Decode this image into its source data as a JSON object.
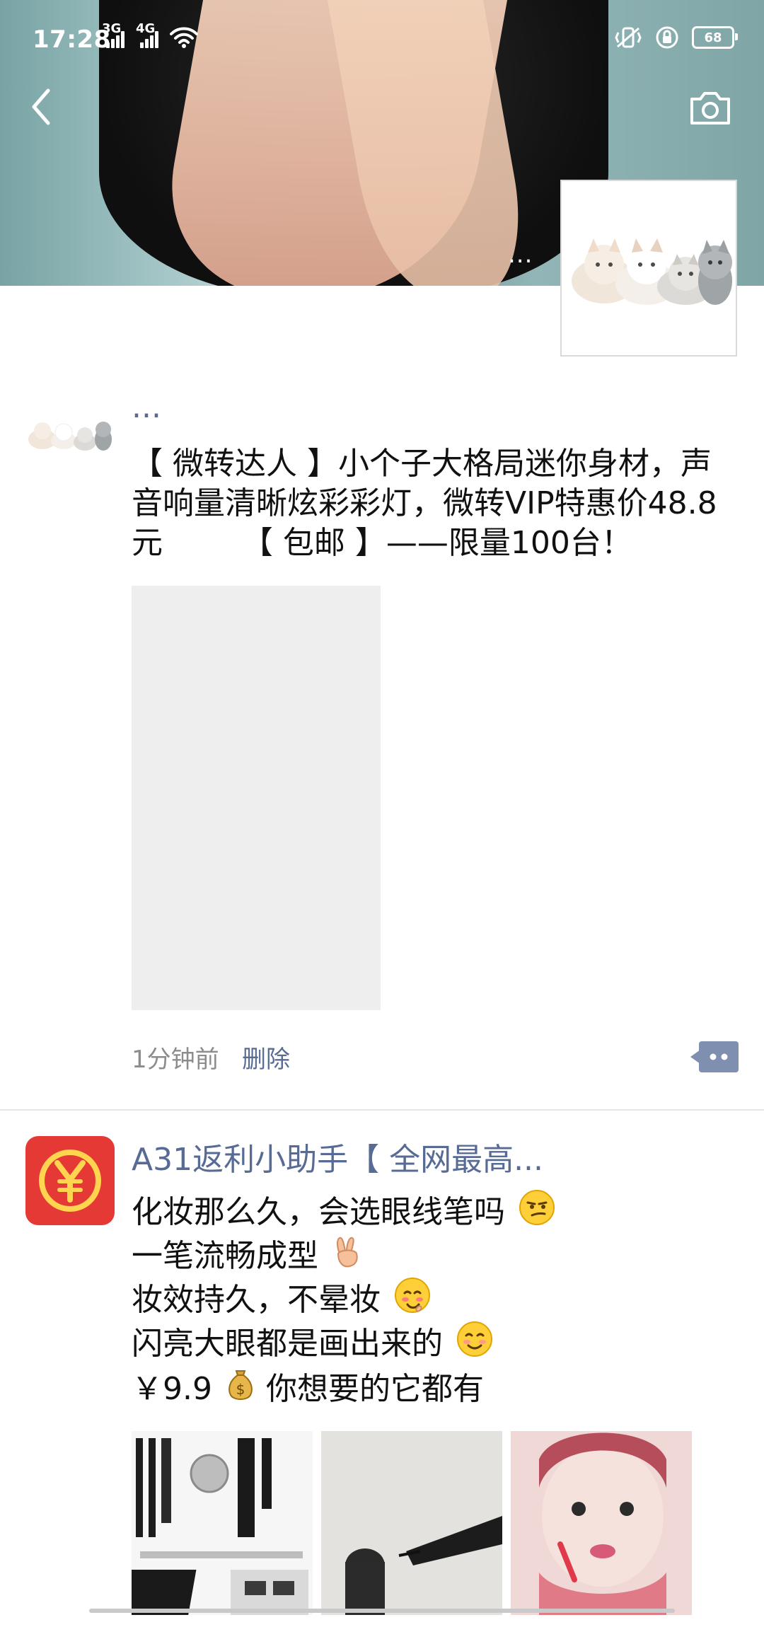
{
  "status_bar": {
    "time": "17:28",
    "net1": "3G",
    "net2": "4G",
    "battery": "68"
  },
  "cover": {
    "more": "..."
  },
  "post1": {
    "name": "...",
    "text": "【 微转达人 】小个子大格局迷你身材，声音响量清晰炫彩彩灯，微转VIP特惠价48.8元        【 包邮 】——限量100台！",
    "time": "1分钟前",
    "delete": "删除"
  },
  "post2": {
    "name": "A31返利小助手【 全网最高...",
    "lines": [
      "化妆那么久，会选眼线笔吗",
      "一笔流畅成型",
      "妆效持久，不晕妆",
      "闪亮大眼都是画出来的",
      "￥9.9",
      "你想要的它都有"
    ]
  },
  "colors": {
    "name_link": "#576b95",
    "meta_text": "#8c8c8c",
    "badge_red": "#e53935",
    "badge_yellow": "#ffd54f"
  },
  "icons": [
    "back-arrow-icon",
    "camera-icon",
    "comment-icon",
    "wifi-icon",
    "signal-icon",
    "battery-icon",
    "money-bag-icon",
    "peace-hand-icon",
    "smirk-icon",
    "blush-icon",
    "smile-icon"
  ]
}
